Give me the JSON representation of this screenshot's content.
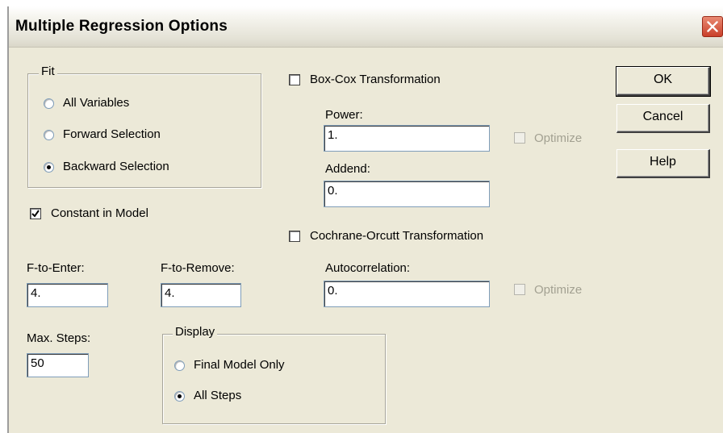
{
  "window": {
    "title": "Multiple Regression Options"
  },
  "fit": {
    "legend": "Fit",
    "options": [
      "All Variables",
      "Forward Selection",
      "Backward Selection"
    ],
    "selected": "Backward Selection"
  },
  "constant": {
    "label": "Constant in Model",
    "checked": true
  },
  "f_to_enter": {
    "label": "F-to-Enter:",
    "value": "4."
  },
  "f_to_remove": {
    "label": "F-to-Remove:",
    "value": "4."
  },
  "max_steps": {
    "label": "Max. Steps:",
    "value": "50"
  },
  "display": {
    "legend": "Display",
    "options": [
      "Final Model Only",
      "All Steps"
    ],
    "selected": "All Steps"
  },
  "box_cox": {
    "label": "Box-Cox Transformation",
    "checked": false,
    "power_label": "Power:",
    "power_value": "1.",
    "addend_label": "Addend:",
    "addend_value": "0.",
    "optimize_label": "Optimize",
    "optimize_enabled": false
  },
  "cochrane": {
    "label": "Cochrane-Orcutt Transformation",
    "checked": false,
    "autocorr_label": "Autocorrelation:",
    "autocorr_value": "0.",
    "optimize_label": "Optimize",
    "optimize_enabled": false
  },
  "buttons": {
    "ok": "OK",
    "cancel": "Cancel",
    "help": "Help"
  }
}
